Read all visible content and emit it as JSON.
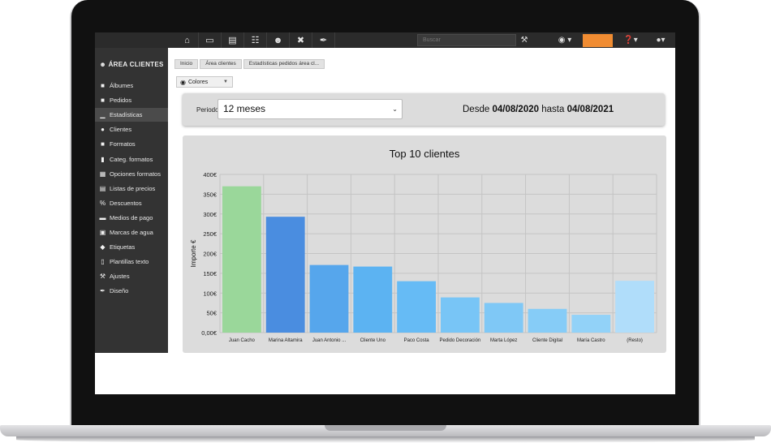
{
  "topbar": {
    "icons": [
      "home-icon",
      "monitor-icon",
      "document-icon",
      "basket-icon",
      "users-icon",
      "tools-icon",
      "brush-icon"
    ],
    "search_placeholder": "Buscar",
    "accent": "#f08c32"
  },
  "sidebar": {
    "title": "ÁREA CLIENTES",
    "items": [
      {
        "label": "Álbumes",
        "icon": "folder-icon"
      },
      {
        "label": "Pedidos",
        "icon": "folder-icon"
      },
      {
        "label": "Estadísticas",
        "icon": "chart-icon",
        "active": true
      },
      {
        "label": "Clientes",
        "icon": "user-icon"
      },
      {
        "label": "Formatos",
        "icon": "folder-icon"
      },
      {
        "label": "Categ. formatos",
        "icon": "bookmark-icon"
      },
      {
        "label": "Opciones formatos",
        "icon": "grid-icon"
      },
      {
        "label": "Listas de precios",
        "icon": "table-icon"
      },
      {
        "label": "Descuentos",
        "icon": "percent-icon"
      },
      {
        "label": "Medios de pago",
        "icon": "card-icon"
      },
      {
        "label": "Marcas de agua",
        "icon": "watermark-icon"
      },
      {
        "label": "Etiquetas",
        "icon": "tag-icon"
      },
      {
        "label": "Plantillas texto",
        "icon": "page-icon"
      },
      {
        "label": "Ajustes",
        "icon": "wrench-icon"
      },
      {
        "label": "Diseño",
        "icon": "brush-icon"
      }
    ]
  },
  "breadcrumb": [
    "Inicio",
    "Área clientes",
    "Estadísticas pedidos área cl..."
  ],
  "colors_button": "Colores",
  "period": {
    "label": "Periodo",
    "selected": "12 meses",
    "range_prefix": "Desde",
    "from": "04/08/2020",
    "range_mid": "hasta",
    "to": "04/08/2021"
  },
  "chart_data": {
    "type": "bar",
    "title": "Top 10 clientes",
    "ylabel": "Importe €",
    "xlabel": "",
    "ylim": [
      0,
      400
    ],
    "yticks": [
      "0,00€",
      "50€",
      "100€",
      "150€",
      "200€",
      "250€",
      "300€",
      "350€",
      "400€"
    ],
    "grid": true,
    "categories": [
      "Juan Cacho",
      "Marina Altamira",
      "Juan Antonio ...",
      "Cliente Uno",
      "Paco Costa",
      "Pedido Decoración",
      "Marta López",
      "Cliente Digital",
      "María Castro",
      "(Resto)"
    ],
    "values": [
      370,
      293,
      171,
      167,
      130,
      89,
      75,
      60,
      45,
      131
    ],
    "colors": [
      "#9ad79a",
      "#4a8de0",
      "#56a6ec",
      "#5cb3f2",
      "#66bbf5",
      "#78c5f6",
      "#7fc8f6",
      "#86ccf7",
      "#92d2f8",
      "#b0ddfa"
    ]
  }
}
